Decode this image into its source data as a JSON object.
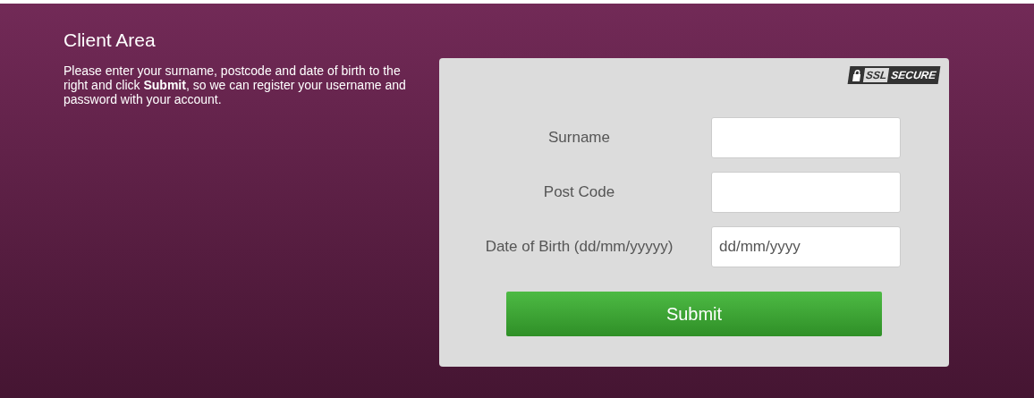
{
  "title": "Client Area",
  "intro": "Please enter your surname, postcode and date of birth to the right and click **Submit**, so we can register your username and password with your account.",
  "badge": {
    "left": "SSL",
    "right": "SECURE"
  },
  "fields": [
    {
      "label": "Surname"
    },
    {
      "label": "Post Code"
    },
    {
      "label": "Date of Birth (dd/mm/yyyyy)",
      "placeholder": "dd/mm/yyyy"
    }
  ],
  "submit": "Submit"
}
